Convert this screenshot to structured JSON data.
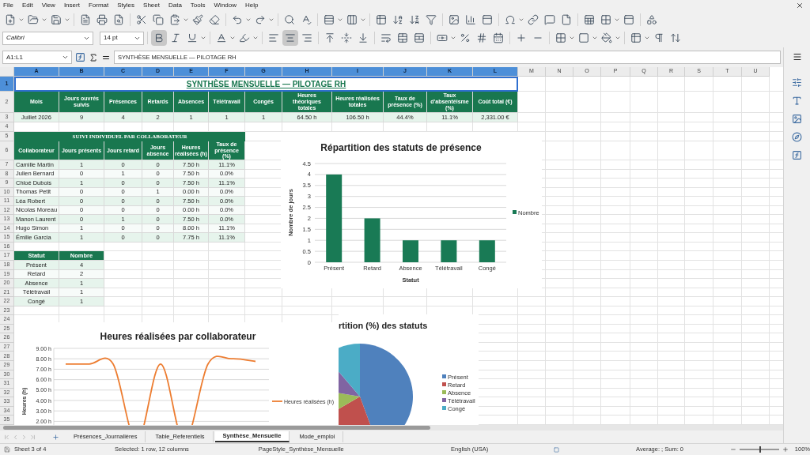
{
  "menu": [
    "File",
    "Edit",
    "View",
    "Insert",
    "Format",
    "Styles",
    "Sheet",
    "Data",
    "Tools",
    "Window",
    "Help"
  ],
  "toolbar": {
    "font_name": "Calibri",
    "font_size": "14 pt",
    "bold_on": true,
    "align_center_on": true
  },
  "formula_bar": {
    "cell_ref": "A1:L1",
    "content": "SYNTHÈSE MENSUELLE — PILOTAGE RH"
  },
  "columns": [
    {
      "label": "A",
      "selected": true
    },
    {
      "label": "B",
      "selected": true
    },
    {
      "label": "C",
      "selected": true
    },
    {
      "label": "D",
      "selected": true
    },
    {
      "label": "E",
      "selected": true
    },
    {
      "label": "F",
      "selected": true
    },
    {
      "label": "G",
      "selected": true
    },
    {
      "label": "H",
      "selected": true
    },
    {
      "label": "I",
      "selected": true
    },
    {
      "label": "J",
      "selected": true
    },
    {
      "label": "K",
      "selected": true
    },
    {
      "label": "L",
      "selected": true
    },
    {
      "label": "M",
      "selected": false
    },
    {
      "label": "N",
      "selected": false
    },
    {
      "label": "O",
      "selected": false
    },
    {
      "label": "P",
      "selected": false
    },
    {
      "label": "Q",
      "selected": false
    },
    {
      "label": "R",
      "selected": false
    },
    {
      "label": "S",
      "selected": false
    },
    {
      "label": "T",
      "selected": false
    },
    {
      "label": "U",
      "selected": false
    }
  ],
  "rows": [
    {
      "label": "1",
      "selected": true
    },
    {
      "label": "2",
      "selected": false
    },
    {
      "label": "3",
      "selected": false
    },
    {
      "label": "4",
      "selected": false
    },
    {
      "label": "5",
      "selected": false
    },
    {
      "label": "6",
      "selected": false
    },
    {
      "label": "7",
      "selected": false
    },
    {
      "label": "8",
      "selected": false
    },
    {
      "label": "9",
      "selected": false
    },
    {
      "label": "10",
      "selected": false
    },
    {
      "label": "11",
      "selected": false
    },
    {
      "label": "12",
      "selected": false
    },
    {
      "label": "13",
      "selected": false
    },
    {
      "label": "14",
      "selected": false
    },
    {
      "label": "15",
      "selected": false
    },
    {
      "label": "16",
      "selected": false
    },
    {
      "label": "17",
      "selected": false
    },
    {
      "label": "18",
      "selected": false
    },
    {
      "label": "19",
      "selected": false
    },
    {
      "label": "20",
      "selected": false
    },
    {
      "label": "21",
      "selected": false
    },
    {
      "label": "22",
      "selected": false
    },
    {
      "label": "23",
      "selected": false
    },
    {
      "label": "24",
      "selected": false
    },
    {
      "label": "25",
      "selected": false
    },
    {
      "label": "26",
      "selected": false
    },
    {
      "label": "27",
      "selected": false
    },
    {
      "label": "28",
      "selected": false
    },
    {
      "label": "29",
      "selected": false
    },
    {
      "label": "30",
      "selected": false
    },
    {
      "label": "31",
      "selected": false
    },
    {
      "label": "32",
      "selected": false
    },
    {
      "label": "33",
      "selected": false
    },
    {
      "label": "34",
      "selected": false
    },
    {
      "label": "35",
      "selected": false
    }
  ],
  "sheet": {
    "title": "SYNTHÈSE MENSUELLE — PILOTAGE RH",
    "summary": {
      "headers": [
        "Mois",
        "Jours ouvrés suivis",
        "Présences",
        "Retards",
        "Absences",
        "Télétravail",
        "Congés",
        "Heures théoriques totales",
        "Heures réalisées totales",
        "Taux de présence (%)",
        "Taux d'absentéisme (%)",
        "Coût total (€)"
      ],
      "values": [
        "Juillet 2026",
        "9",
        "4",
        "2",
        "1",
        "1",
        "1",
        "64.50 h",
        "106.50 h",
        "44.4%",
        "11.1%",
        "2,331.00 €"
      ]
    },
    "individual": {
      "title": "SUIVI INDIVIDUEL PAR COLLABORATEUR",
      "headers": [
        "Collaborateur",
        "Jours présents",
        "Jours retard",
        "Jours absence",
        "Heures réalisées (h)",
        "Taux de présence (%)"
      ],
      "rows": [
        [
          "Camille Martin",
          "1",
          "0",
          "0",
          "7.50 h",
          "11.1%"
        ],
        [
          "Julien Bernard",
          "0",
          "1",
          "0",
          "7.50 h",
          "0.0%"
        ],
        [
          "Chloé Dubois",
          "1",
          "0",
          "0",
          "7.50 h",
          "11.1%"
        ],
        [
          "Thomas Petit",
          "0",
          "0",
          "1",
          "0.00 h",
          "0.0%"
        ],
        [
          "Léa Robert",
          "0",
          "0",
          "0",
          "7.50 h",
          "0.0%"
        ],
        [
          "Nicolas Moreau",
          "0",
          "0",
          "0",
          "0.00 h",
          "0.0%"
        ],
        [
          "Manon Laurent",
          "0",
          "1",
          "0",
          "7.50 h",
          "0.0%"
        ],
        [
          "Hugo Simon",
          "1",
          "0",
          "0",
          "8.00 h",
          "11.1%"
        ],
        [
          "Émilie Garcia",
          "1",
          "0",
          "0",
          "7.75 h",
          "11.1%"
        ]
      ]
    },
    "status_table": {
      "headers": [
        "Statut",
        "Nombre"
      ],
      "rows": [
        [
          "Présent",
          "4"
        ],
        [
          "Retard",
          "2"
        ],
        [
          "Absence",
          "1"
        ],
        [
          "Télétravail",
          "1"
        ],
        [
          "Congé",
          "1"
        ]
      ]
    }
  },
  "bar_chart": {
    "chart_data": {
      "type": "bar",
      "title": "Répartition des statuts de présence",
      "xlabel": "Statut",
      "ylabel": "Nombre de jours",
      "categories": [
        "Présent",
        "Retard",
        "Absence",
        "Télétravail",
        "Congé"
      ],
      "series": [
        {
          "name": "Nombre",
          "color": "#197a55",
          "values": [
            4,
            2,
            1,
            1,
            1
          ]
        }
      ],
      "ylim": [
        0,
        4.5
      ],
      "yticks": [
        0,
        0.5,
        1,
        1.5,
        2,
        2.5,
        3,
        3.5,
        4,
        4.5
      ],
      "grid": true,
      "legend": "right"
    }
  },
  "line_chart": {
    "chart_data": {
      "type": "line",
      "title": "Heures réalisées par collaborateur",
      "ylabel": "Heures (h)",
      "series": [
        {
          "name": "Heures réalisées (h)",
          "color": "#ed7d31",
          "values": [
            7.5,
            7.5,
            7.5,
            0,
            7.5,
            0,
            7.5,
            8,
            7.75
          ]
        }
      ],
      "yticks": [
        {
          "value": 2,
          "label": "2.00 h"
        },
        {
          "value": 3,
          "label": "3.00 h"
        },
        {
          "value": 4,
          "label": "4.00 h"
        },
        {
          "value": 5,
          "label": "5.00 h"
        },
        {
          "value": 6,
          "label": "6.00 h"
        },
        {
          "value": 7,
          "label": "7.00 h"
        },
        {
          "value": 8,
          "label": "8.00 h"
        },
        {
          "value": 9,
          "label": "9.00 h"
        }
      ],
      "ylim": [
        0,
        9
      ],
      "grid": true,
      "legend": "right"
    }
  },
  "pie_chart": {
    "chart_data": {
      "type": "pie",
      "title": "rtition (%) des statuts",
      "categories": [
        "Présent",
        "Retard",
        "Absence",
        "Télétravail",
        "Congé"
      ],
      "series": [
        {
          "values": [
            44.4,
            22.2,
            11.1,
            11.1,
            11.2
          ]
        }
      ],
      "legend": "right",
      "colors": [
        "#4f81bd",
        "#c0504d",
        "#9bbb59",
        "#8064a2",
        "#4bacc6"
      ]
    }
  },
  "sheet_tabs": [
    {
      "label": "Présences_Journalières",
      "selected": false
    },
    {
      "label": "Table_Referentiels",
      "selected": false
    },
    {
      "label": "Synthèse_Mensuelle",
      "selected": true
    },
    {
      "label": "Mode_emploi",
      "selected": false
    }
  ],
  "status_bar": {
    "sheet": "Sheet 3 of 4",
    "selection": "Selected: 1 row, 12 columns",
    "page_style": "PageStyle_Synthèse_Mensuelle",
    "language": "English (USA)",
    "summary": "Average: ; Sum: 0",
    "zoom": "100%",
    "zoom_level": {
      "level": 0.5
    }
  }
}
